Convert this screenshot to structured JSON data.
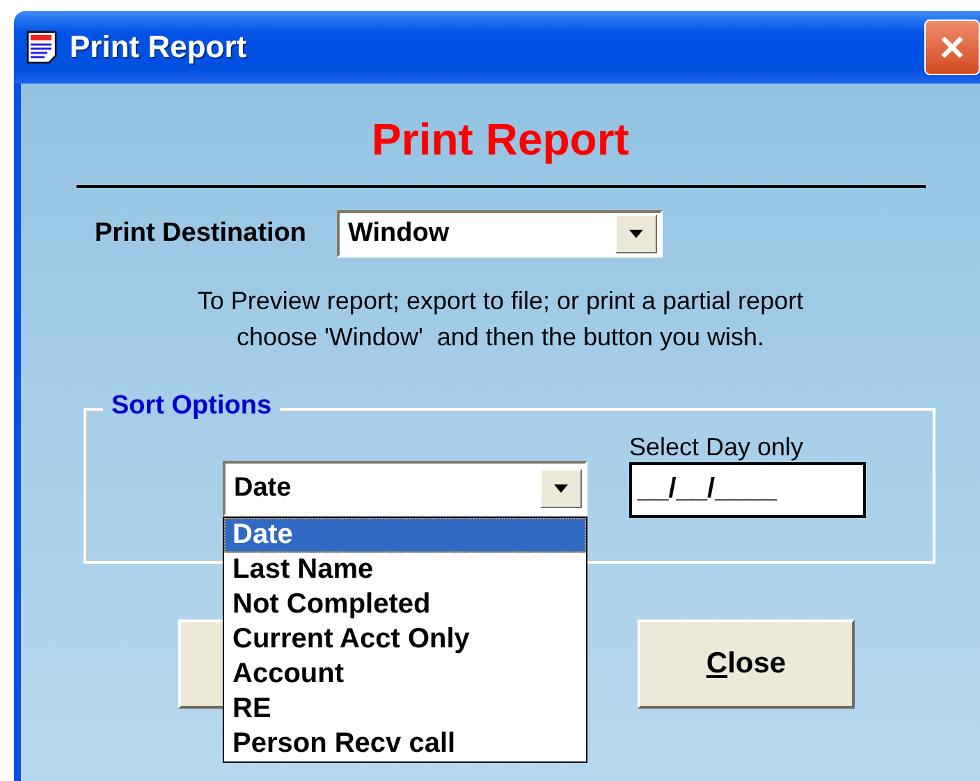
{
  "window": {
    "title": "Print Report"
  },
  "heading": "Print Report",
  "print_destination": {
    "label": "Print Destination",
    "value": "Window"
  },
  "instructions": "To Preview report; export to file; or print a partial report\nchoose 'Window'  and then the button you wish.",
  "sort_options": {
    "legend": "Sort Options",
    "value": "Date",
    "expanded": true,
    "options": [
      {
        "label": "Date",
        "selected": true
      },
      {
        "label": "Last Name",
        "selected": false
      },
      {
        "label": "Not Completed",
        "selected": false
      },
      {
        "label": "Current Acct Only",
        "selected": false
      },
      {
        "label": "Account",
        "selected": false
      },
      {
        "label": "RE",
        "selected": false
      },
      {
        "label": "Person Recv call",
        "selected": false
      }
    ]
  },
  "select_day": {
    "label": "Select Day only",
    "value": "__/__/____"
  },
  "close_button": {
    "label": "Close"
  }
}
